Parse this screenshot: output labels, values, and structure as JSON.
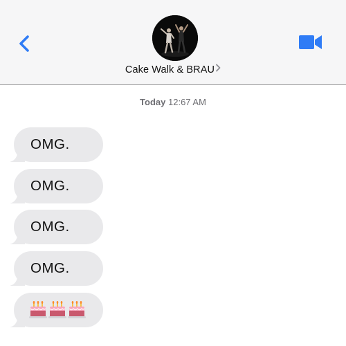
{
  "header": {
    "contact_name": "Cake Walk & BRAU",
    "colors": {
      "accent": "#2f7cf6",
      "header_bg": "#f6f6f7"
    }
  },
  "timestamp": {
    "day": "Today",
    "time": "12:67 AM"
  },
  "messages": [
    {
      "text": "OMG."
    },
    {
      "text": "OMG."
    },
    {
      "text": "OMG."
    },
    {
      "text": "OMG."
    },
    {
      "emoji": [
        "birthday-cake",
        "birthday-cake",
        "birthday-cake"
      ]
    }
  ],
  "bubble_color": "#e9e9eb"
}
